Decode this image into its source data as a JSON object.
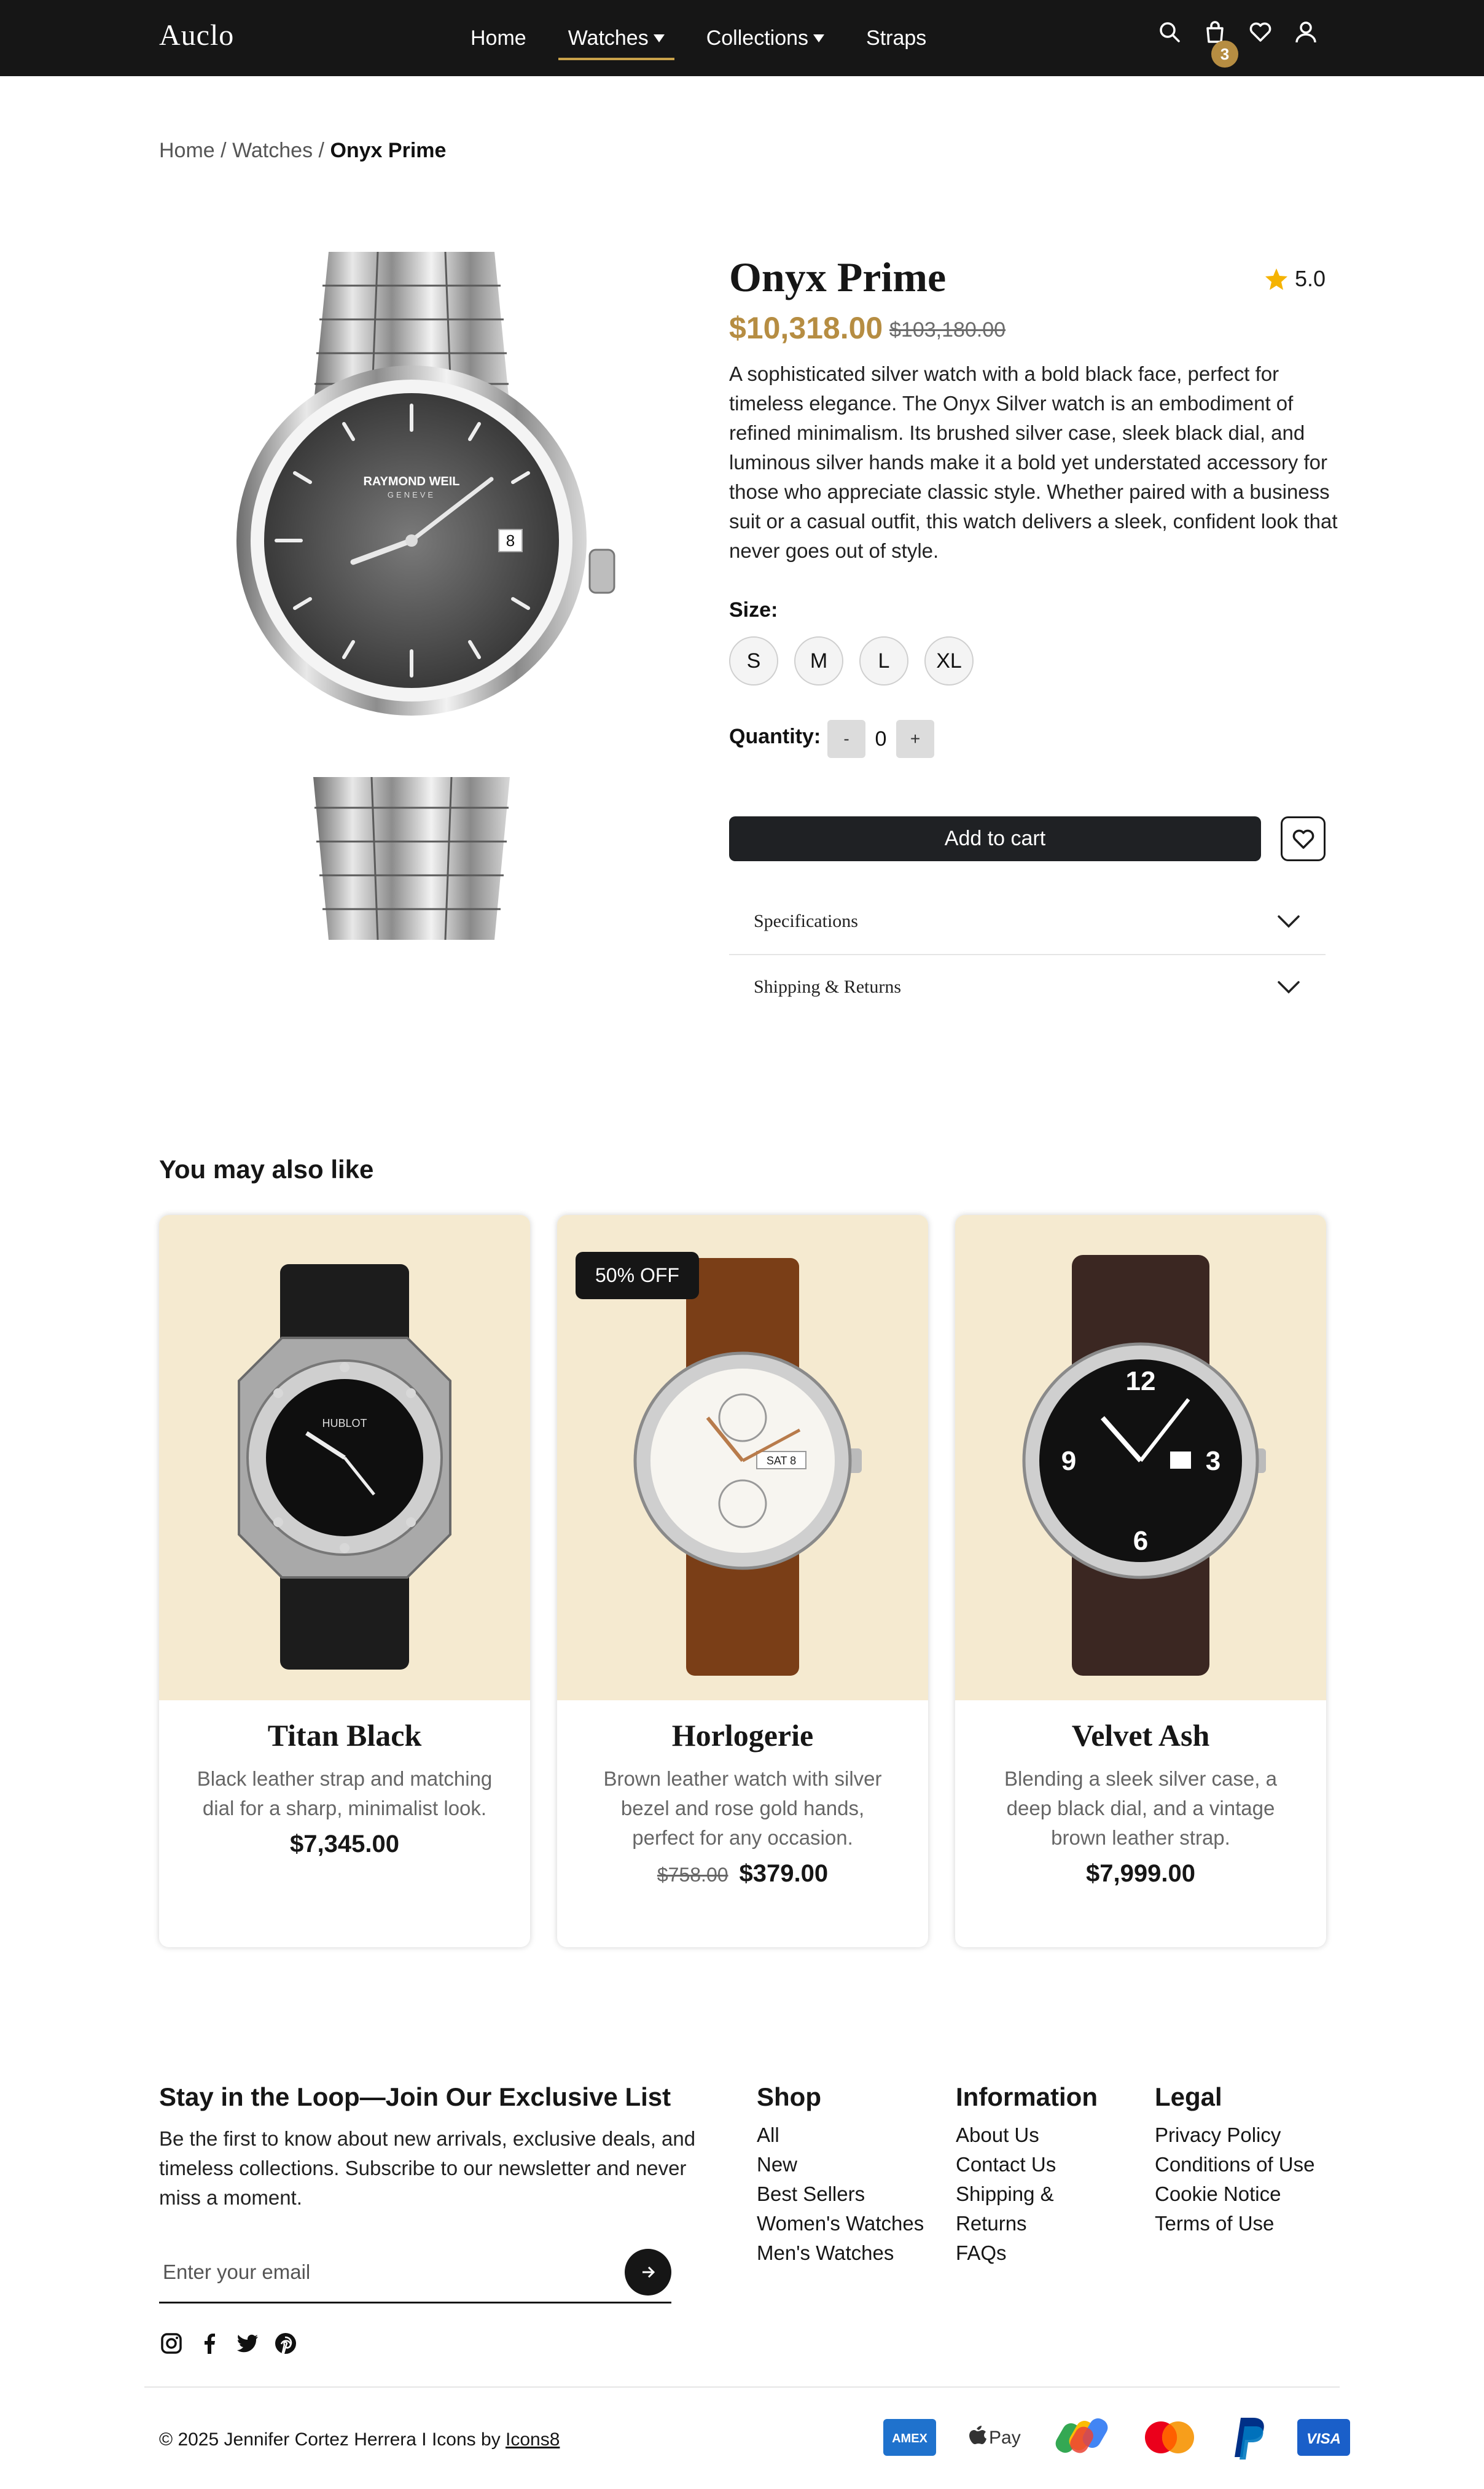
{
  "nav": {
    "logo": "Auclo",
    "links": [
      {
        "label": "Home"
      },
      {
        "label": "Watches"
      },
      {
        "label": "Collections"
      },
      {
        "label": "Straps"
      }
    ],
    "cart_count": "3"
  },
  "breadcrumb": {
    "home": "Home",
    "sep1": "/",
    "watches": "Watches",
    "sep2": "/",
    "current": "Onyx Prime"
  },
  "product": {
    "title": "Onyx Prime",
    "rating": "5.0",
    "price": "$10,318.00",
    "old_price": "$103,180.00",
    "description": "A sophisticated silver watch with a bold black face, perfect for timeless elegance. The Onyx Silver watch is an embodiment of refined minimalism. Its brushed silver case, sleek black dial, and luminous silver hands make it a bold yet understated accessory for those who appreciate classic style. Whether paired with a business suit or a casual outfit, this watch delivers a sleek, confident look that never goes out of style.",
    "size_label": "Size:",
    "sizes": [
      "S",
      "M",
      "L",
      "XL"
    ],
    "quantity_label": "Quantity:",
    "qty_minus": "-",
    "quantity": "0",
    "qty_plus": "+",
    "add_to_cart": "Add to cart",
    "accordions": [
      "Specifications",
      "Shipping & Returns"
    ]
  },
  "recommendations": {
    "title": "You may also like",
    "items": [
      {
        "name": "Titan Black",
        "description": "Black leather strap and matching dial for a sharp, minimalist look.",
        "price": "$7,345.00"
      },
      {
        "name": "Horlogerie",
        "badge": "50% OFF",
        "description": "Brown leather watch with silver bezel and rose gold hands, perfect for any occasion.",
        "old_price": "$758.00",
        "price": "$379.00"
      },
      {
        "name": "Velvet Ash",
        "description": "Blending a sleek silver case, a deep black dial, and a vintage brown leather strap.",
        "price": "$7,999.00"
      }
    ]
  },
  "footer": {
    "newsletter_title": "Stay in the Loop—Join Our Exclusive List",
    "newsletter_text": "Be the first to know about new arrivals, exclusive deals, and timeless collections. Subscribe to our newsletter and never miss a moment.",
    "email_placeholder": "Enter your email",
    "columns": [
      {
        "title": "Shop",
        "links": [
          "All",
          "New",
          "Best Sellers",
          "Women's Watches",
          "Men's Watches"
        ]
      },
      {
        "title": "Information",
        "links": [
          "About Us",
          "Contact Us",
          "Shipping &",
          "Returns",
          "FAQs"
        ]
      },
      {
        "title": "Legal",
        "links": [
          "Privacy Policy",
          "Conditions of Use",
          "Cookie Notice",
          "Terms of Use"
        ]
      }
    ],
    "copyright": "© 2025 Jennifer Cortez Herrera I Icons by ",
    "icons_credit": "Icons8",
    "payments": {
      "amex": "AMEX",
      "applepay": "Pay",
      "visa": "VISA"
    }
  },
  "colors": {
    "accent": "#b68d42",
    "nav_bg": "#161616",
    "card_bg": "#f5ead0",
    "rating_star": "#f5b301"
  }
}
